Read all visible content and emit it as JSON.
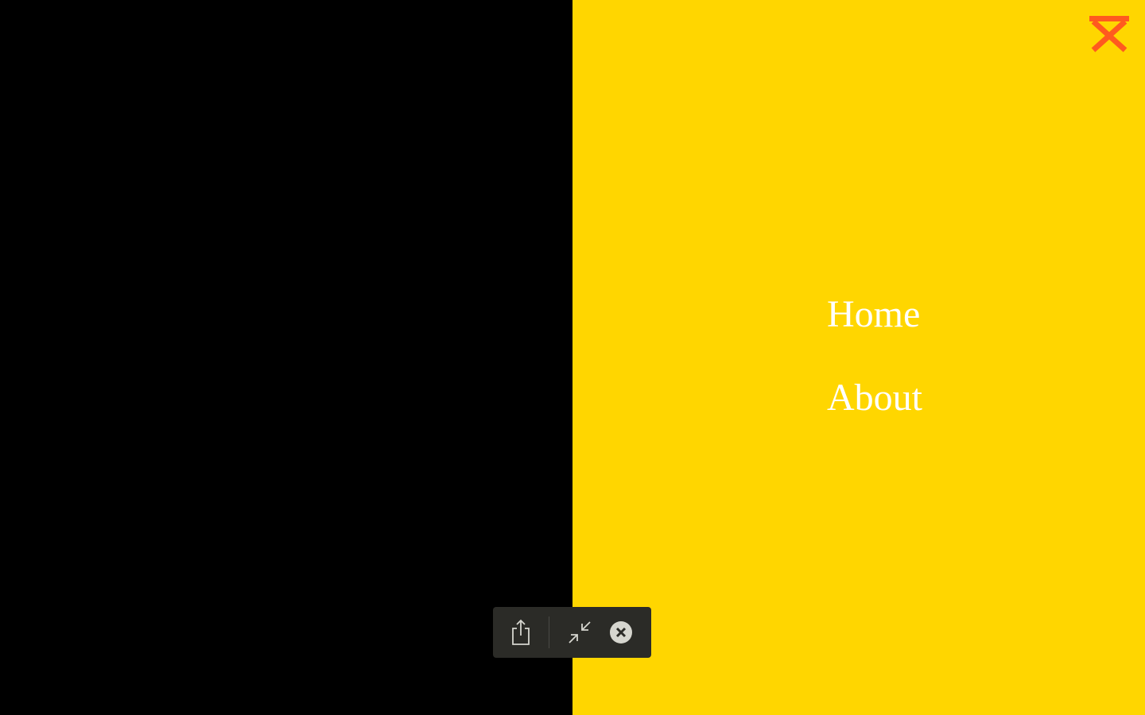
{
  "colors": {
    "left_background": "#000000",
    "right_background": "#FFD600",
    "close_icon": "#FF5A1F",
    "nav_text": "#FFFFFF",
    "toolbar_background": "#2B2B27",
    "toolbar_icon": "#D6D6CF"
  },
  "close_button": {
    "icon": "close-x-icon"
  },
  "nav": {
    "items": [
      {
        "label": "Home"
      },
      {
        "label": "About"
      }
    ]
  },
  "toolbar": {
    "buttons": [
      {
        "icon": "share-icon"
      },
      {
        "icon": "collapse-icon"
      },
      {
        "icon": "close-circle-icon"
      }
    ]
  }
}
